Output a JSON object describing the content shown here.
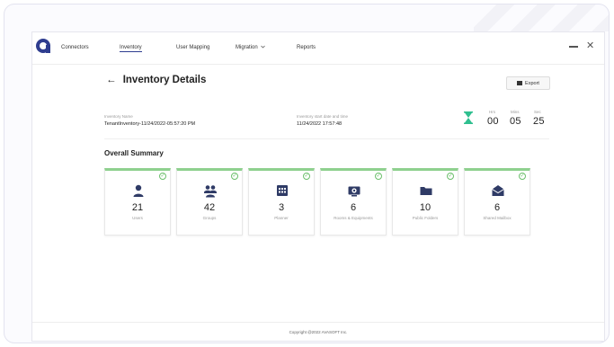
{
  "nav": {
    "items": [
      {
        "label": "Connectors"
      },
      {
        "label": "Inventory"
      },
      {
        "label": "User Mapping"
      },
      {
        "label": "Migration"
      },
      {
        "label": "Reports"
      }
    ],
    "migration_chevron": "chevron-down-icon",
    "close_glyph": "✕"
  },
  "page": {
    "back_arrow": "←",
    "title": "Inventory Details",
    "export_label": "Export"
  },
  "inventory": {
    "name_label": "Inventory Name",
    "name_value": "TenantInventory-11/24/2022-05:57:20 PM",
    "date_label": "Inventory start date and time",
    "date_value": "11/24/2022 17:57:48"
  },
  "timer": {
    "hrs_label": "Hrs",
    "hrs": "00",
    "mins_label": "Mins",
    "mins": "05",
    "sec_label": "Sec",
    "sec": "25"
  },
  "summary": {
    "title": "Overall Summary",
    "cards": [
      {
        "count": "21",
        "label": "Users",
        "icon": "user-icon"
      },
      {
        "count": "42",
        "label": "Groups",
        "icon": "groups-icon"
      },
      {
        "count": "3",
        "label": "Planner",
        "icon": "planner-icon"
      },
      {
        "count": "6",
        "label": "Rooms & Equipments",
        "icon": "equipment-icon"
      },
      {
        "count": "10",
        "label": "Public Folders",
        "icon": "folder-icon"
      },
      {
        "count": "6",
        "label": "Shared Mailbox",
        "icon": "mailbox-icon"
      }
    ]
  },
  "footer": {
    "copyright": "Copyright @2022 AVASOFT Inc."
  },
  "colors": {
    "brand": "#2f3d8f",
    "success": "#8ed08e",
    "icon": "#2f3b66",
    "hourglass": "#2fbf8f"
  }
}
